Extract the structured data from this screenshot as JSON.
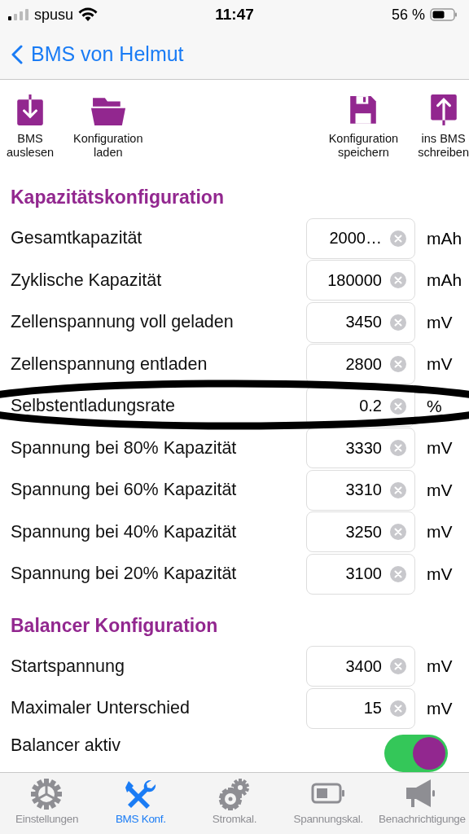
{
  "status_bar": {
    "carrier": "spusu",
    "time": "11:47",
    "battery": "56 %"
  },
  "nav": {
    "back_title": "BMS von Helmut"
  },
  "toolbar": [
    {
      "kind": "download",
      "label": "BMS\nauslesen"
    },
    {
      "kind": "folder",
      "label": "Konfiguration\nladen"
    },
    {
      "kind": "spacer"
    },
    {
      "kind": "save",
      "label": "Konfiguration\nspeichern"
    },
    {
      "kind": "upload",
      "label": "ins BMS\nschreiben"
    }
  ],
  "sections": [
    {
      "title": "Kapazitätskonfiguration",
      "rows": [
        {
          "kind": "field",
          "label": "Gesamtkapazität",
          "value": "2000…",
          "unit": "mAh"
        },
        {
          "kind": "field",
          "label": "Zyklische Kapazität",
          "value": "180000",
          "unit": "mAh"
        },
        {
          "kind": "field",
          "label": "Zellenspannung voll geladen",
          "value": "3450",
          "unit": "mV"
        },
        {
          "kind": "field",
          "label": "Zellenspannung entladen",
          "value": "2800",
          "unit": "mV"
        },
        {
          "kind": "field",
          "label": "Selbstentladungsrate",
          "value": "0.2",
          "unit": "%"
        },
        {
          "kind": "field",
          "label": "Spannung bei 80% Kapazität",
          "value": "3330",
          "unit": "mV"
        },
        {
          "kind": "field",
          "label": "Spannung bei 60% Kapazität",
          "value": "3310",
          "unit": "mV"
        },
        {
          "kind": "field",
          "label": "Spannung bei 40% Kapazität",
          "value": "3250",
          "unit": "mV"
        },
        {
          "kind": "field",
          "label": "Spannung bei 20% Kapazität",
          "value": "3100",
          "unit": "mV"
        }
      ]
    },
    {
      "title": "Balancer Konfiguration",
      "rows": [
        {
          "kind": "field",
          "label": "Startspannung",
          "value": "3400",
          "unit": "mV"
        },
        {
          "kind": "field",
          "label": "Maximaler Unterschied",
          "value": "15",
          "unit": "mV"
        },
        {
          "kind": "toggle",
          "label": "Balancer aktiv",
          "on": true
        }
      ]
    }
  ],
  "tabs": [
    {
      "kind": "gear",
      "label": "Einstellungen",
      "selected": false
    },
    {
      "kind": "tools",
      "label": "BMS Konf.",
      "selected": true
    },
    {
      "kind": "gears",
      "label": "Stromkal.",
      "selected": false
    },
    {
      "kind": "battery",
      "label": "Spannungskal.",
      "selected": false
    },
    {
      "kind": "megaphone",
      "label": "Benachrichtigunge",
      "selected": false
    }
  ]
}
